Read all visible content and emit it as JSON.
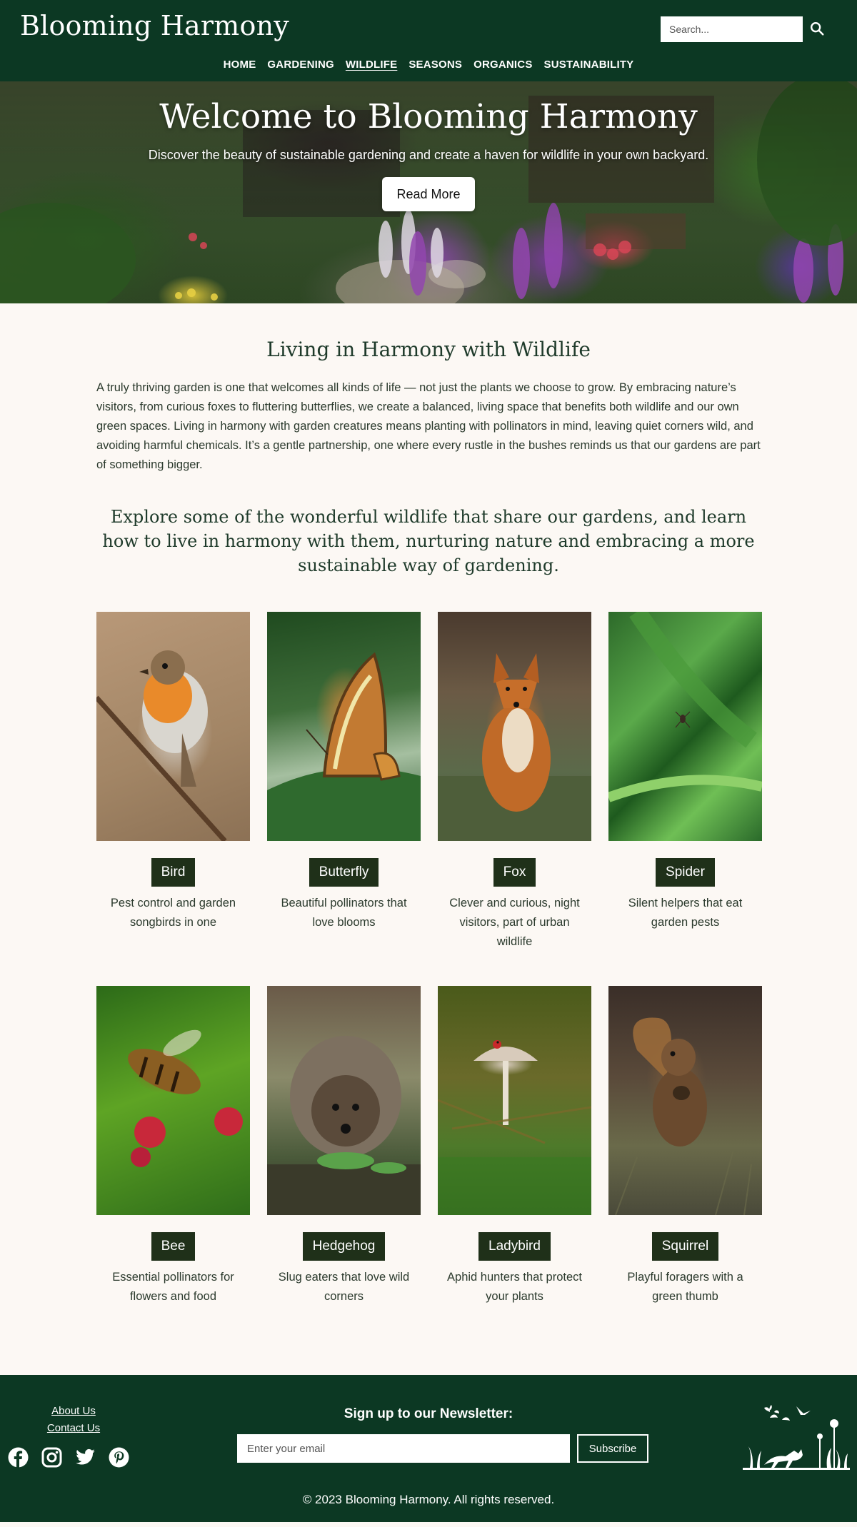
{
  "header": {
    "logo": "Blooming Harmony",
    "search_placeholder": "Search...",
    "nav": [
      "HOME",
      "GARDENING",
      "WILDLIFE",
      "SEASONS",
      "ORGANICS",
      "SUSTAINABILITY"
    ],
    "active_nav": "WILDLIFE"
  },
  "hero": {
    "title": "Welcome to Blooming Harmony",
    "subtitle": "Discover the beauty of sustainable gardening and create a haven for wildlife in your own backyard.",
    "button": "Read More"
  },
  "main": {
    "section_title": "Living in Harmony with Wildlife",
    "intro": "A truly thriving garden is one that welcomes all kinds of life — not just the plants we choose to grow. By embracing nature’s visitors, from curious foxes to fluttering butterflies, we create a balanced, living space that benefits both wildlife and our own green spaces. Living in harmony with garden creatures means planting with pollinators in mind, leaving quiet corners wild, and avoiding harmful chemicals. It’s a gentle partnership, one where every rustle in the bushes reminds us that our gardens are part of something bigger.",
    "explore": "Explore some of the wonderful wildlife that share our gardens, and learn how to live in harmony with them, nurturing nature and embracing a more sustainable way of gardening.",
    "cards": [
      {
        "label": "Bird",
        "desc": "Pest control and garden songbirds in one"
      },
      {
        "label": "Butterfly",
        "desc": "Beautiful pollinators that love blooms"
      },
      {
        "label": "Fox",
        "desc": "Clever and curious, night visitors, part of urban wildlife"
      },
      {
        "label": "Spider",
        "desc": "Silent helpers that eat garden pests"
      },
      {
        "label": "Bee",
        "desc": "Essential pollinators for flowers and food"
      },
      {
        "label": "Hedgehog",
        "desc": "Slug eaters that love wild corners"
      },
      {
        "label": "Ladybird",
        "desc": "Aphid hunters that protect your plants"
      },
      {
        "label": "Squirrel",
        "desc": "Playful foragers with a green thumb"
      }
    ]
  },
  "footer": {
    "links": [
      "About Us",
      "Contact Us"
    ],
    "social_icons": [
      "facebook-icon",
      "instagram-icon",
      "twitter-icon",
      "pinterest-icon"
    ],
    "newsletter_title": "Sign up to our Newsletter:",
    "email_placeholder": "Enter your email",
    "subscribe": "Subscribe",
    "copyright": "© 2023 Blooming Harmony. All rights reserved."
  },
  "colors": {
    "brand_green": "#0c3823",
    "label_bg": "#1f3019",
    "page_bg": "#fcf8f4"
  }
}
